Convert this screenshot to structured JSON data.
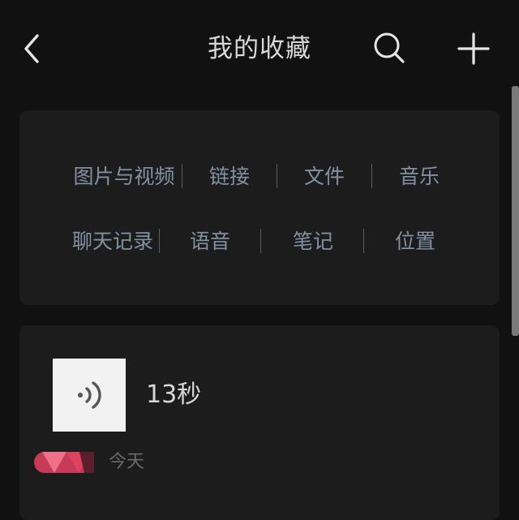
{
  "header": {
    "back_icon": "chevron-left-icon",
    "title": "我的收藏",
    "search_icon": "search-icon",
    "add_icon": "plus-icon"
  },
  "categories": {
    "row1": [
      "图片与视频",
      "链接",
      "文件",
      "音乐"
    ],
    "row2": [
      "聊天记录",
      "语音",
      "笔记",
      "位置"
    ]
  },
  "favorite_item": {
    "type_icon": "voice-wave-icon",
    "duration": "13秒",
    "date": "今天",
    "tag_colors": [
      "#e0415f",
      "#f0708a",
      "#c73a58"
    ]
  },
  "colors": {
    "background": "#111111",
    "panel": "#1c1c1c",
    "category_text": "#8190a3"
  }
}
